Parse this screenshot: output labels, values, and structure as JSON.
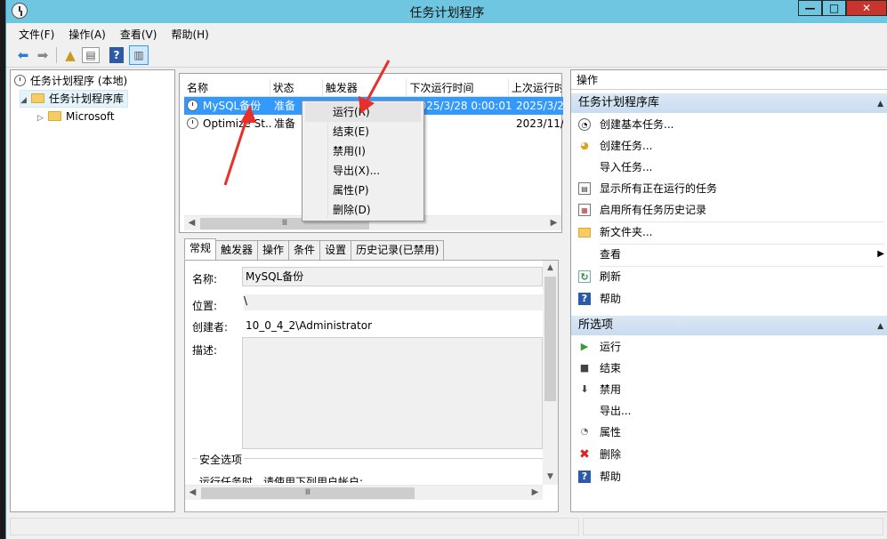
{
  "window": {
    "title": "任务计划程序",
    "controls": {
      "minimize": "—",
      "maximize": "□",
      "close": "✕"
    }
  },
  "menubar": [
    "文件(F)",
    "操作(A)",
    "查看(V)",
    "帮助(H)"
  ],
  "tree": {
    "root": "任务计划程序 (本地)",
    "library": "任务计划程序库",
    "child": "Microsoft"
  },
  "task_list": {
    "columns": [
      "名称",
      "状态",
      "触发器",
      "下次运行时间",
      "上次运行时"
    ],
    "rows": [
      {
        "name": "MySQL备份",
        "status": "准备",
        "trigger": "",
        "next": "2025/3/28 0:00:01",
        "last": "2025/3/2"
      },
      {
        "name": "Optimize St...",
        "status": "准备",
        "trigger": "",
        "next": "",
        "last": "2023/11/"
      }
    ],
    "scroll_thumb": "Ⅲ"
  },
  "context_menu": [
    "运行(R)",
    "结束(E)",
    "禁用(I)",
    "导出(X)...",
    "属性(P)",
    "删除(D)"
  ],
  "detail_tabs": [
    "常规",
    "触发器",
    "操作",
    "条件",
    "设置",
    "历史记录(已禁用)"
  ],
  "general": {
    "name_label": "名称:",
    "name_value": "MySQL备份",
    "location_label": "位置:",
    "location_value": "\\",
    "author_label": "创建者:",
    "author_value": "10_0_4_2\\Administrator",
    "desc_label": "描述:",
    "security_title": "安全选项",
    "security_text": "运行任务时，请使用下列用户帐户:"
  },
  "actions_pane": {
    "header": "操作",
    "section1": "任务计划程序库",
    "items1": [
      {
        "label": "创建基本任务...",
        "icon": "create-basic-task-icon"
      },
      {
        "label": "创建任务...",
        "icon": "create-task-icon"
      },
      {
        "label": "导入任务...",
        "icon": ""
      },
      {
        "label": "显示所有正在运行的任务",
        "icon": "running-tasks-icon"
      },
      {
        "label": "启用所有任务历史记录",
        "icon": "history-icon"
      },
      {
        "label": "新文件夹...",
        "icon": "new-folder-icon"
      },
      {
        "label": "查看",
        "icon": "",
        "submenu": true
      },
      {
        "label": "刷新",
        "icon": "refresh-icon"
      },
      {
        "label": "帮助",
        "icon": "help-icon"
      }
    ],
    "section2": "所选项",
    "items2": [
      {
        "label": "运行",
        "icon": "run-icon"
      },
      {
        "label": "结束",
        "icon": "stop-icon"
      },
      {
        "label": "禁用",
        "icon": "disable-icon"
      },
      {
        "label": "导出...",
        "icon": ""
      },
      {
        "label": "属性",
        "icon": "properties-icon"
      },
      {
        "label": "删除",
        "icon": "delete-icon"
      },
      {
        "label": "帮助",
        "icon": "help-icon"
      }
    ]
  },
  "colors": {
    "titlebar": "#6ec6e0",
    "selection": "#3399ff",
    "close_button": "#c7352c",
    "annotation_arrow": "#e8302a"
  }
}
